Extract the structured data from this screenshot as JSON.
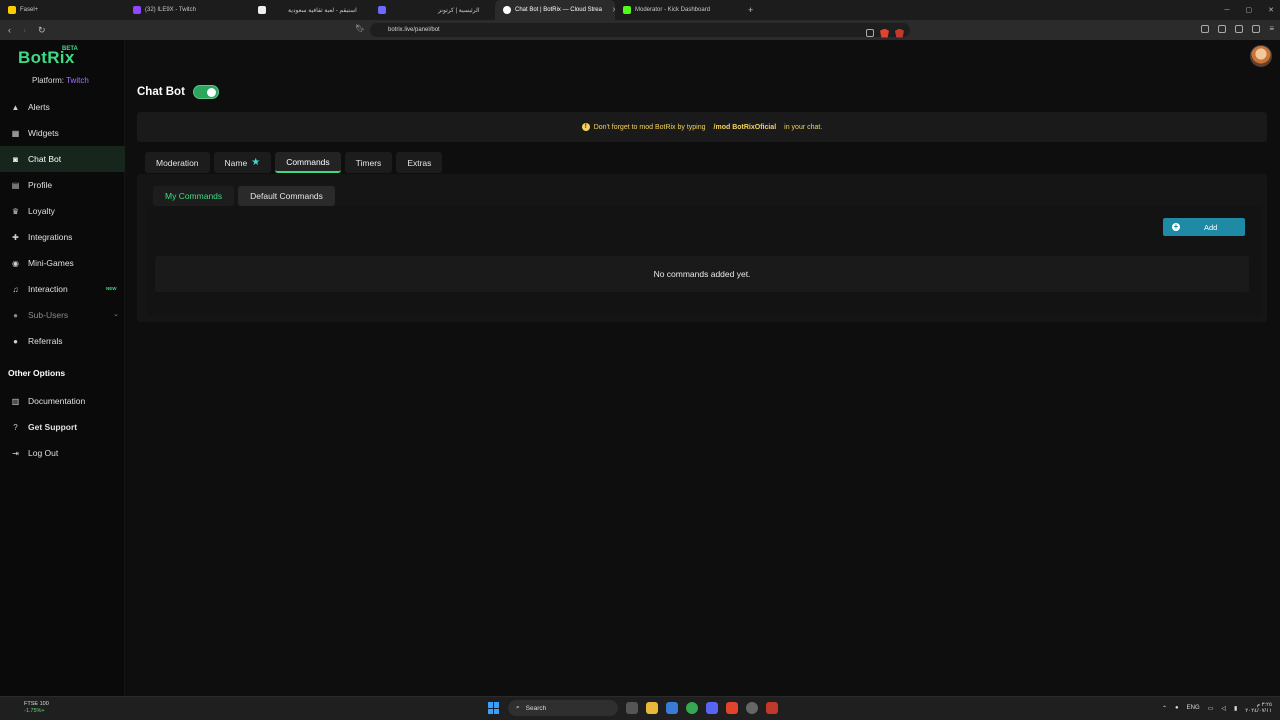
{
  "browser": {
    "tabs": [
      {
        "title": "Fasel+",
        "color": "#ffcc00"
      },
      {
        "title": "(32) ILE9X - Twitch",
        "color": "#9146ff"
      },
      {
        "title": "",
        "color": "#ffffff"
      },
      {
        "title": "استيقم - لعبة ثقافية سعودية",
        "color": "#444444"
      },
      {
        "title": "",
        "color": "#6a6aff"
      },
      {
        "title": "الرئيسية | كرتونز",
        "color": "#444444"
      },
      {
        "title": "Chat Bot | BotRix — Cloud Strea",
        "color": "#ffffff",
        "active": true
      },
      {
        "title": "Moderator - Kick Dashboard",
        "color": "#53fc18"
      }
    ],
    "url": "botrix.live/panel/bot"
  },
  "sidebar": {
    "logo": "BotRix",
    "beta": "BETA",
    "platform_label": "Platform:",
    "platform_value": "Twitch",
    "items": [
      {
        "label": "Alerts",
        "icon": "bell-icon"
      },
      {
        "label": "Widgets",
        "icon": "grid-icon"
      },
      {
        "label": "Chat Bot",
        "icon": "robot-icon"
      },
      {
        "label": "Profile",
        "icon": "profile-icon"
      },
      {
        "label": "Loyalty",
        "icon": "trophy-icon"
      },
      {
        "label": "Integrations",
        "icon": "puzzle-icon"
      },
      {
        "label": "Mini-Games",
        "icon": "gamepad-icon"
      },
      {
        "label": "Interaction",
        "icon": "music-icon",
        "badge": "NEW"
      },
      {
        "label": "Sub-Users",
        "icon": "users-icon"
      },
      {
        "label": "Referrals",
        "icon": "referral-icon"
      }
    ],
    "other_title": "Other Options",
    "other_items": [
      {
        "label": "Documentation",
        "icon": "book-icon"
      },
      {
        "label": "Get Support",
        "icon": "help-icon"
      },
      {
        "label": "Log Out",
        "icon": "logout-icon"
      }
    ]
  },
  "main": {
    "title": "Chat Bot",
    "bot_enabled": true,
    "notice": {
      "before": "Don't forget to mod BotRix by typing",
      "command": "/mod BotRixOficial",
      "after": "in your chat."
    },
    "tabs": [
      "Moderation",
      "Name",
      "Commands",
      "Timers",
      "Extras"
    ],
    "active_tab": "Commands",
    "subtabs": [
      "My Commands",
      "Default Commands"
    ],
    "active_subtab": "My Commands",
    "add_label": "Add",
    "empty_text": "No commands added yet."
  },
  "taskbar": {
    "ticker_name": "FTSE 100",
    "ticker_value": "-1.75%+",
    "search": "Search",
    "lang": "ENG",
    "time": "٣:٢٥ م",
    "date": "٢٠٢٤/٠٧/١١"
  },
  "colors": {
    "accent": "#3ddc84",
    "add_button": "#1f8aa6",
    "notice": "#f3d35a",
    "twitch": "#a970ff"
  }
}
